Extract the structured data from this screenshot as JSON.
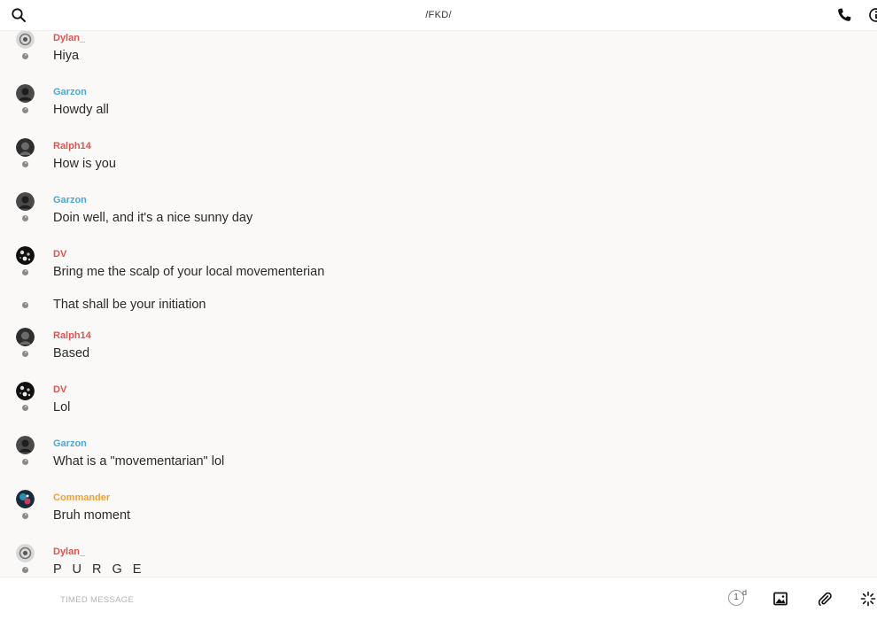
{
  "header": {
    "title": "/FKD/",
    "icons": [
      "search-icon",
      "phone-icon",
      "info-icon"
    ]
  },
  "messages": [
    {
      "user": "Dylan_",
      "color": "#e0524f",
      "text": "Hiya"
    },
    {
      "user": "Garzon",
      "color": "#4ba9d9",
      "text": "Howdy all"
    },
    {
      "user": "Ralph14",
      "color": "#e0524f",
      "text": "How is you"
    },
    {
      "user": "Garzon",
      "color": "#4ba9d9",
      "text": "Doin well, and it's a nice sunny day"
    },
    {
      "user": "DV",
      "color": "#e0524f",
      "text": "Bring me the scalp of your local movementerian"
    },
    {
      "user": "",
      "text": "That shall be your initiation"
    },
    {
      "user": "Ralph14",
      "color": "#e0524f",
      "text": "Based"
    },
    {
      "user": "DV",
      "color": "#e0524f",
      "text": "Lol"
    },
    {
      "user": "Garzon",
      "color": "#4ba9d9",
      "text": "What is a \"movementarian\" lol"
    },
    {
      "user": "Commander",
      "color": "#f0a233",
      "text": "Bruh moment"
    },
    {
      "user": "Dylan_",
      "color": "#e0524f",
      "text": "P U R G E"
    }
  ],
  "composer": {
    "placeholder": "TIMED MESSAGE",
    "timer_value": "1",
    "timer_unit": "d",
    "icons": [
      "image-icon",
      "paperclip-icon",
      "sparkle-icon"
    ]
  }
}
